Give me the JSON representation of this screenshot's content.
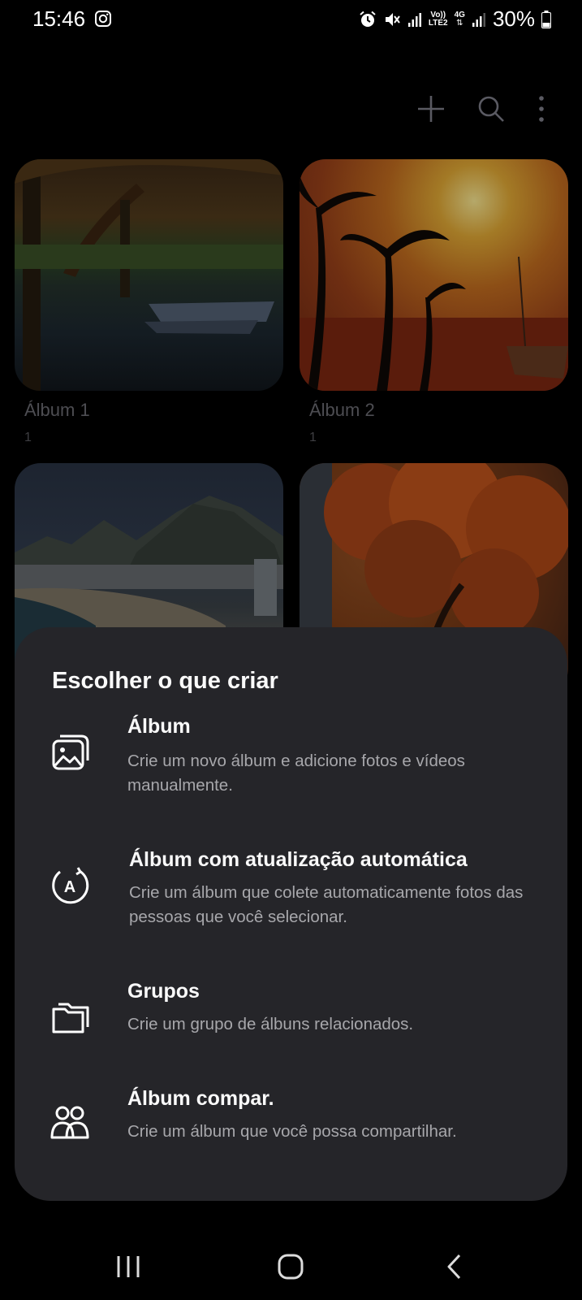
{
  "status_bar": {
    "time": "15:46",
    "battery": "30%",
    "network": "4G",
    "volte_line1": "Vo))",
    "volte_line2": "LTE2"
  },
  "toolbar": {
    "icons": [
      "plus-icon",
      "search-icon",
      "more-vert-icon"
    ]
  },
  "albums": [
    {
      "title": "Álbum 1",
      "count": "1"
    },
    {
      "title": "Álbum 2",
      "count": "1"
    },
    {
      "title": "",
      "count": ""
    },
    {
      "title": "",
      "count": ""
    }
  ],
  "sheet": {
    "title": "Escolher o que criar",
    "options": [
      {
        "title": "Álbum",
        "desc": "Crie um novo álbum e adicione fotos e vídeos manualmente.",
        "icon": "album-image-icon"
      },
      {
        "title": "Álbum com atualização automática",
        "desc": "Crie um álbum que colete automaticamente fotos das pessoas que você selecionar.",
        "icon": "auto-update-album-icon"
      },
      {
        "title": "Grupos",
        "desc": "Crie um grupo de álbuns relacionados.",
        "icon": "folder-group-icon"
      },
      {
        "title": "Álbum compar.",
        "desc": "Crie um álbum que você possa compartilhar.",
        "icon": "shared-people-icon"
      }
    ]
  },
  "navbar": {
    "icons": [
      "recents-icon",
      "home-icon",
      "back-icon"
    ]
  },
  "colors": {
    "sheet_bg": "#252529",
    "text_primary": "#fafafa",
    "text_secondary": "#a7a7ab"
  }
}
